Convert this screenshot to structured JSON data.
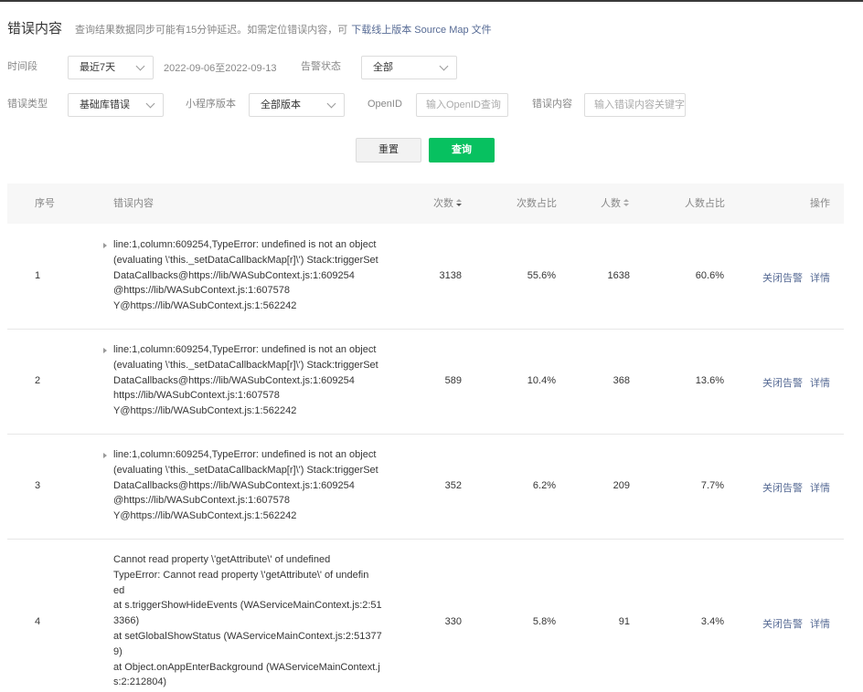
{
  "header": {
    "title": "错误内容",
    "hint": "查询结果数据同步可能有15分钟延迟。如需定位错误内容，可",
    "link": "下载线上版本 Source Map 文件"
  },
  "filters": {
    "period_label": "时间段",
    "period_value": "最近7天",
    "date_range": "2022-09-06至2022-09-13",
    "alert_label": "告警状态",
    "alert_value": "全部",
    "type_label": "错误类型",
    "type_value": "基础库错误",
    "version_label": "小程序版本",
    "version_value": "全部版本",
    "openid_label": "OpenID",
    "openid_placeholder": "输入OpenID查询",
    "content_label": "错误内容",
    "content_placeholder": "输入错误内容关键字"
  },
  "actions": {
    "reset": "重置",
    "query": "查询"
  },
  "table": {
    "headers": {
      "index": "序号",
      "content": "错误内容",
      "count": "次数",
      "count_ratio": "次数占比",
      "users": "人数",
      "user_ratio": "人数占比",
      "ops": "操作"
    },
    "close_label": "关闭告警",
    "detail_label": "详情",
    "rows": [
      {
        "index": "1",
        "lines": [
          "line:1,column:609254,TypeError: undefined is not an object",
          "(evaluating \\'this._setDataCallbackMap[r]\\') Stack:triggerSet",
          "DataCallbacks@https://lib/WASubContext.js:1:609254",
          "@https://lib/WASubContext.js:1:607578",
          "Y@https://lib/WASubContext.js:1:562242"
        ],
        "count": "3138",
        "count_ratio": "55.6%",
        "users": "1638",
        "user_ratio": "60.6%"
      },
      {
        "index": "2",
        "lines": [
          "line:1,column:609254,TypeError: undefined is not an object",
          "(evaluating \\'this._setDataCallbackMap[r]\\') Stack:triggerSet",
          "DataCallbacks@https://lib/WASubContext.js:1:609254",
          "https://lib/WASubContext.js:1:607578",
          "Y@https://lib/WASubContext.js:1:562242"
        ],
        "count": "589",
        "count_ratio": "10.4%",
        "users": "368",
        "user_ratio": "13.6%"
      },
      {
        "index": "3",
        "lines": [
          "line:1,column:609254,TypeError: undefined is not an object",
          "(evaluating \\'this._setDataCallbackMap[r]\\') Stack:triggerSet",
          "DataCallbacks@https://lib/WASubContext.js:1:609254",
          "@https://lib/WASubContext.js:1:607578",
          "Y@https://lib/WASubContext.js:1:562242"
        ],
        "count": "352",
        "count_ratio": "6.2%",
        "users": "209",
        "user_ratio": "7.7%"
      },
      {
        "index": "4",
        "lines": [
          "Cannot read property \\'getAttribute\\' of undefined",
          "TypeError: Cannot read property \\'getAttribute\\' of undefin",
          "ed",
          "at s.triggerShowHideEvents (WAServiceMainContext.js:2:51",
          "3366)",
          "at setGlobalShowStatus (WAServiceMainContext.js:2:51377",
          "9)",
          "at Object.onAppEnterBackground (WAServiceMainContext.j",
          "s:2:212804)"
        ],
        "count": "330",
        "count_ratio": "5.8%",
        "users": "91",
        "user_ratio": "3.4%"
      }
    ]
  }
}
